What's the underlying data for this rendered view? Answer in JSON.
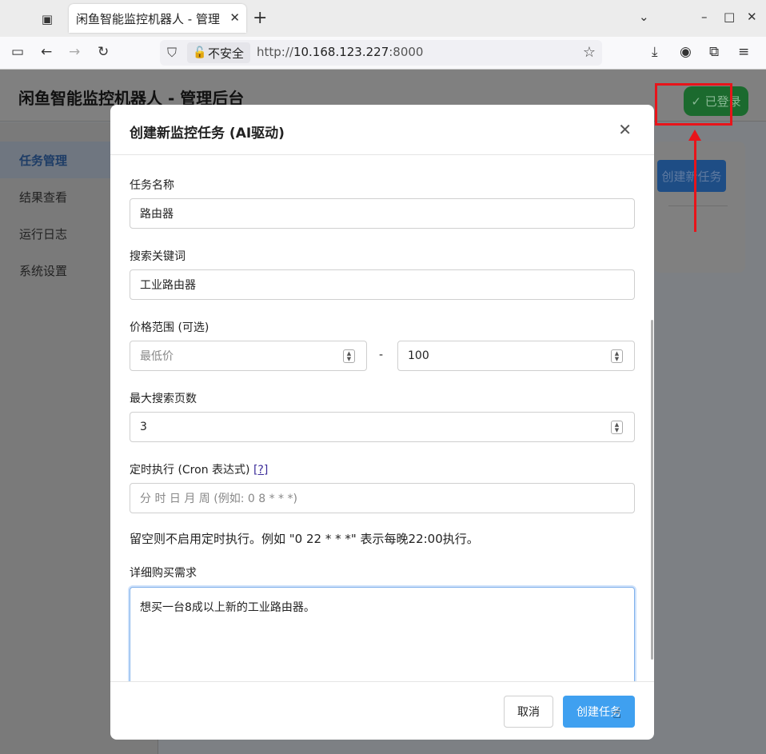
{
  "browser": {
    "tab_title": "闲鱼智能监控机器人 - 管理后台",
    "security_label": "不安全",
    "url_prefix": "http://",
    "url_host": "10.168.123.227",
    "url_port": ":8000"
  },
  "page": {
    "brand": "闲鱼智能监控机器人 - 管理后台",
    "login_status": "✓ 已登录",
    "sidebar": [
      {
        "label": "任务管理"
      },
      {
        "label": "结果查看"
      },
      {
        "label": "运行日志"
      },
      {
        "label": "系统设置"
      }
    ],
    "create_task_button": "创建新任务"
  },
  "modal": {
    "title": "创建新监控任务 (AI驱动)",
    "task_name_label": "任务名称",
    "task_name_value": "路由器",
    "keyword_label": "搜索关键词",
    "keyword_value": "工业路由器",
    "price_label": "价格范围 (可选)",
    "price_min_placeholder": "最低价",
    "price_separator": "-",
    "price_max_value": "100",
    "max_pages_label": "最大搜索页数",
    "max_pages_value": "3",
    "cron_label": "定时执行 (Cron 表达式)",
    "cron_help": "[?]",
    "cron_placeholder": "分 时 日 月 周 (例如: 0 8 * * *)",
    "cron_hint": "留空则不启用定时执行。例如 \"0 22 * * *\" 表示每晚22:00执行。",
    "description_label": "详细购买需求",
    "description_value": "想买一台8成以上新的工业路由器。",
    "cancel_button": "取消",
    "create_button": "创建任务"
  },
  "colors": {
    "primary": "#3fa0f0",
    "annotation": "#e8141a",
    "login_badge": "#1b6a2e"
  }
}
